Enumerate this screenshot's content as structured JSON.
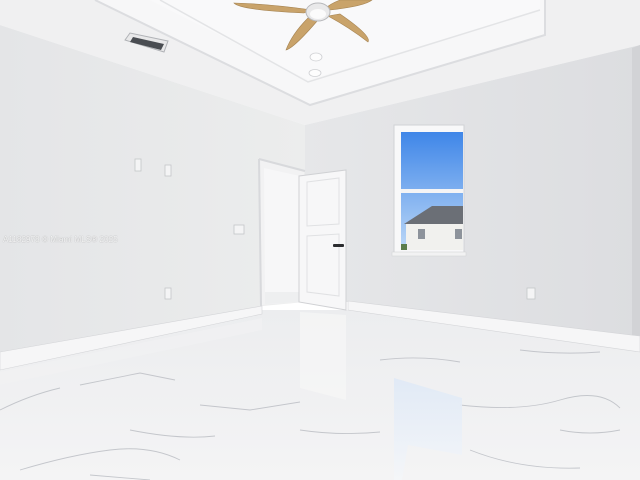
{
  "watermark": {
    "text": "A1182978 © Miami MLS® 2025"
  }
}
